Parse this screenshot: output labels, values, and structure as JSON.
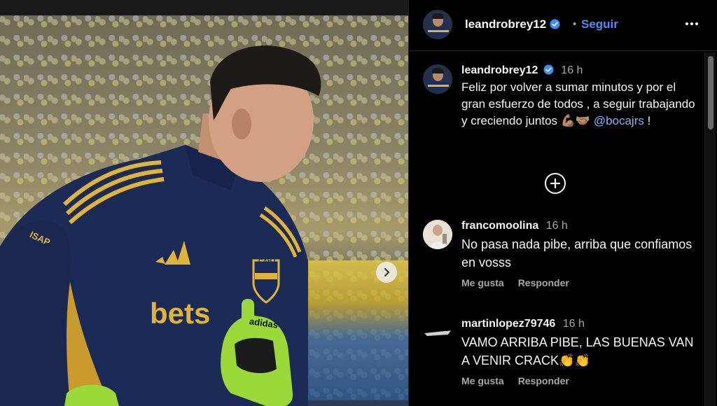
{
  "post": {
    "username": "leandrobrey12",
    "follow_label": "Seguir",
    "dot": "•",
    "caption_time": "16 h",
    "caption_text": "Feliz por volver a sumar minutos y por el gran esfuerzo de todos , a seguir trabajando y creciendo juntos 💪🏽🤝🏽",
    "caption_mention": "@bocajrs",
    "caption_end": " !"
  },
  "photo": {
    "shirt_text": "bets",
    "brand": "adidas",
    "badge": "CABJ",
    "sleeve_text": "ISAP"
  },
  "comments": [
    {
      "username": "francomoolina",
      "time": "16 h",
      "text": "No pasa nada pibe, arriba que confiamos en vosss",
      "like_label": "Me gusta",
      "reply_label": "Responder"
    },
    {
      "username": "martinlopez79746",
      "time": "16 h",
      "text": "VAMO ARRIBA PIBE, LAS BUENAS VAN A VENIR CRACK👏👏",
      "like_label": "Me gusta",
      "reply_label": "Responder",
      "avatar_text": "METALLICA"
    }
  ],
  "colors": {
    "accent": "#4f8df7",
    "mention": "#8bb3f7",
    "verified": "#3a8ef6",
    "shirt_navy": "#1c2b56",
    "shirt_gold": "#e0b43a",
    "glove_green": "#9bd93b"
  },
  "icons": [
    "verified-icon",
    "more-options-icon",
    "add-circle-icon",
    "chevron-right-icon"
  ]
}
